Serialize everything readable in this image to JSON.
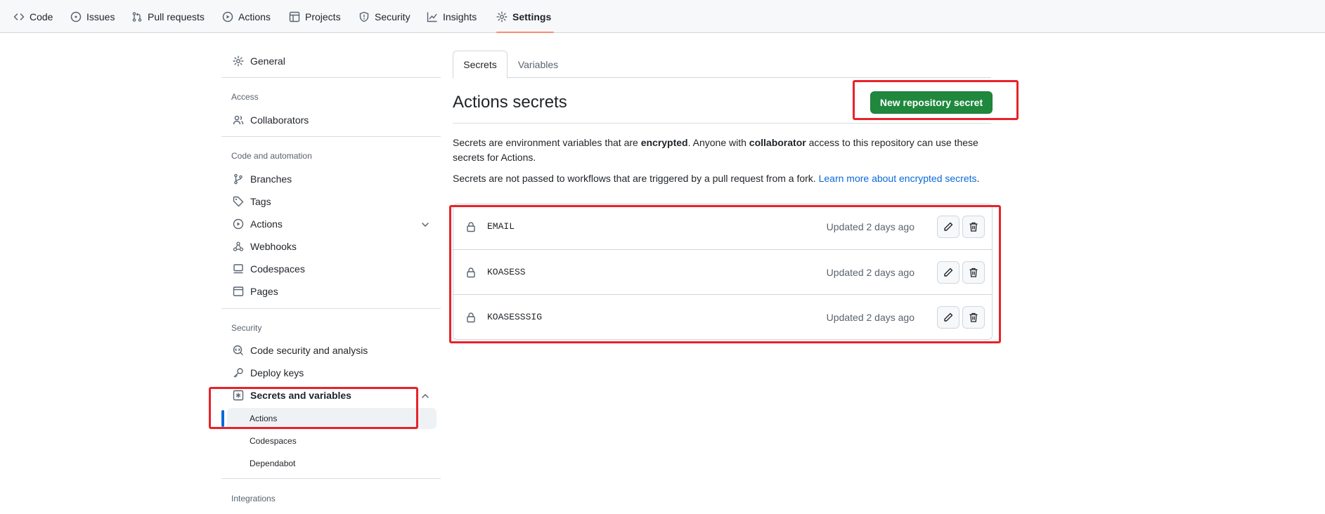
{
  "repo_nav": {
    "items": [
      {
        "label": "Code",
        "icon": "code-icon"
      },
      {
        "label": "Issues",
        "icon": "issue-icon"
      },
      {
        "label": "Pull requests",
        "icon": "pull-request-icon"
      },
      {
        "label": "Actions",
        "icon": "play-icon"
      },
      {
        "label": "Projects",
        "icon": "table-icon"
      },
      {
        "label": "Security",
        "icon": "shield-icon"
      },
      {
        "label": "Insights",
        "icon": "graph-icon"
      },
      {
        "label": "Settings",
        "icon": "gear-icon",
        "selected": true
      }
    ],
    "selected_underline_color": "#fd8c73"
  },
  "sidebar": {
    "general": "General",
    "sections": {
      "access": {
        "heading": "Access",
        "items": [
          "Collaborators"
        ]
      },
      "code_automation": {
        "heading": "Code and automation",
        "items": [
          "Branches",
          "Tags",
          "Actions",
          "Webhooks",
          "Codespaces",
          "Pages"
        ]
      },
      "security": {
        "heading": "Security",
        "items": [
          "Code security and analysis",
          "Deploy keys",
          "Secrets and variables"
        ]
      },
      "integrations": {
        "heading": "Integrations"
      }
    },
    "secrets_sub": [
      "Actions",
      "Codespaces",
      "Dependabot"
    ],
    "active_sub": "Actions",
    "active_color": "#0969da"
  },
  "main": {
    "tabs": [
      {
        "label": "Secrets",
        "active": true
      },
      {
        "label": "Variables",
        "active": false
      }
    ],
    "title": "Actions secrets",
    "new_button": "New repository secret",
    "desc1": {
      "t1": "Secrets are environment variables that are ",
      "b1": "encrypted",
      "t2": ". Anyone with ",
      "b2": "collaborator",
      "t3": " access to this repository can use these secrets for Actions."
    },
    "desc2": {
      "text": "Secrets are not passed to workflows that are triggered by a pull request from a fork. ",
      "link": "Learn more about encrypted secrets",
      "end": "."
    },
    "secrets": [
      {
        "name": "EMAIL",
        "updated": "Updated 2 days ago"
      },
      {
        "name": "KOASESS",
        "updated": "Updated 2 days ago"
      },
      {
        "name": "KOASESSSIG",
        "updated": "Updated 2 days ago"
      }
    ]
  },
  "colors": {
    "primary_button": "#1f883d",
    "link": "#0969da",
    "annotation_red": "#e8222a"
  }
}
